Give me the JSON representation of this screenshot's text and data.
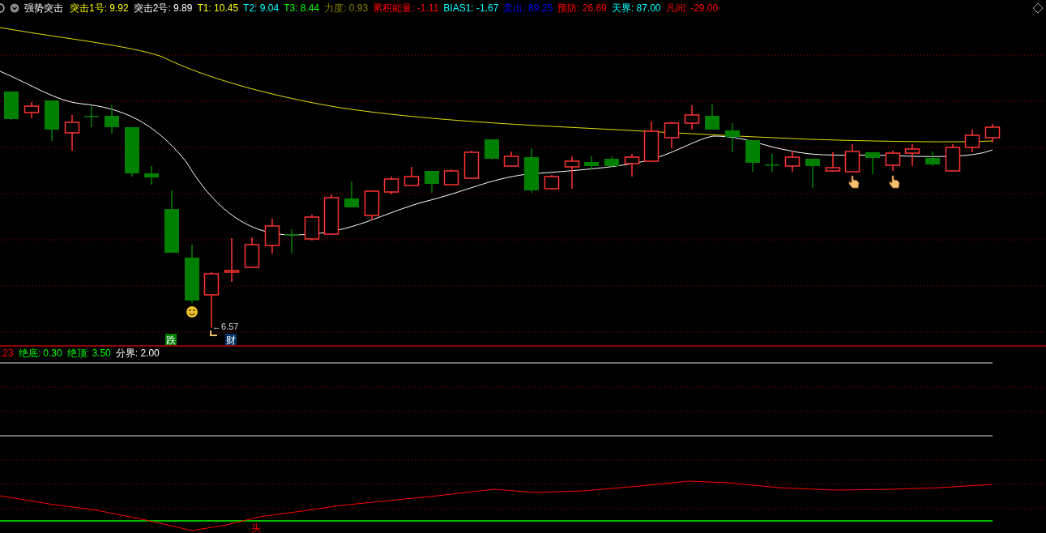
{
  "header": {
    "title": "强势突击",
    "indicators": [
      {
        "label": "突击1号:",
        "value": "9.92",
        "color": "#ffff00"
      },
      {
        "label": "突击2号:",
        "value": "9.89",
        "color": "#ffffff"
      },
      {
        "label": "T1:",
        "value": "10.45",
        "color": "#ffff00"
      },
      {
        "label": "T2:",
        "value": "9.04",
        "color": "#00ffff"
      },
      {
        "label": "T3:",
        "value": "8.44",
        "color": "#00ff00"
      },
      {
        "label": "力度:",
        "value": "0.93",
        "color": "#808000"
      },
      {
        "label": "累积能量:",
        "value": "-1.11",
        "color": "#ff0000"
      },
      {
        "label": "BIAS1:",
        "value": "-1.67",
        "color": "#00ffff"
      },
      {
        "label": "卖出:",
        "value": "89.25",
        "color": "#0000ff"
      },
      {
        "label": "预防:",
        "value": "26.69",
        "color": "#ff0000"
      },
      {
        "label": "天界:",
        "value": "87.00",
        "color": "#00ffff"
      },
      {
        "label": "凡间:",
        "value": "-29.00",
        "color": "#ff0000"
      }
    ]
  },
  "main_chart": {
    "low_price_label": "←6.57",
    "marks": [
      {
        "text": "跌",
        "color": "#008000"
      },
      {
        "text": "财",
        "color": "#003366"
      }
    ]
  },
  "sub_panel": {
    "indicators": [
      {
        "value": ".23",
        "color": "#ff0000"
      },
      {
        "label": "绝底:",
        "value": "0.30",
        "color": "#00ff00"
      },
      {
        "label": "绝顶:",
        "value": "3.50",
        "color": "#00ff00"
      },
      {
        "label": "分界:",
        "value": "2.00",
        "color": "#ffffff"
      }
    ],
    "bottom_mark": "头"
  }
}
